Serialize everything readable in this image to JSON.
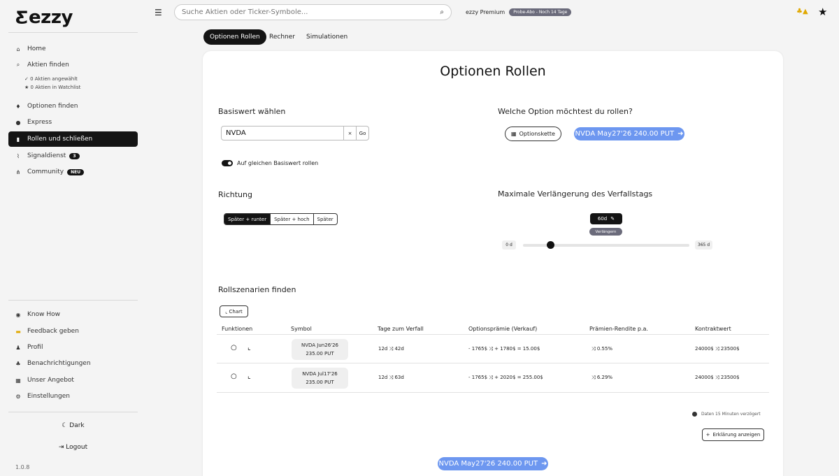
{
  "logo": {
    "text": "ezzy",
    "mark": "Ƹ"
  },
  "sidebar": {
    "items": [
      {
        "icon": "⌂",
        "label": "Home"
      },
      {
        "icon": "⌕",
        "label": "Aktien finden"
      },
      {
        "icon": "♦",
        "label": "Optionen finden"
      },
      {
        "icon": "●",
        "label": "Express"
      },
      {
        "icon": "▮",
        "label": "Rollen und schließen"
      },
      {
        "icon": "⌇",
        "label": "Signaldienst",
        "badge": "3"
      },
      {
        "icon": "⋔",
        "label": "Community",
        "badge": "NEU"
      }
    ],
    "subs": [
      {
        "icon": "✓",
        "label": "0 Aktien angewählt"
      },
      {
        "icon": "★",
        "label": "0 Aktien in Watchlist"
      }
    ],
    "bottom": [
      {
        "icon": "◉",
        "label": "Know How"
      },
      {
        "icon": "▬",
        "label": "Feedback geben"
      },
      {
        "icon": "♟",
        "label": "Profil"
      },
      {
        "icon": "♣",
        "label": "Benachrichtigungen"
      },
      {
        "icon": "▦",
        "label": "Unser Angebot"
      },
      {
        "icon": "⚙",
        "label": "Einstellungen"
      }
    ],
    "dark": "Dark",
    "logout": "Logout",
    "version": "1.0.8"
  },
  "topbar": {
    "search_placeholder": "Suche Aktien oder Ticker-Symbole...",
    "premium": "ezzy Premium",
    "trial": "Probe-Abo - Noch 14 Tage"
  },
  "tabs": [
    "Optionen Rollen",
    "Rechner",
    "Simulationen"
  ],
  "main": {
    "title": "Optionen Rollen",
    "basis_title": "Basiswert wählen",
    "ticker_value": "NVDA",
    "clear": "×",
    "go": "Go",
    "toggle_label": "Auf gleichen Basiswert rollen",
    "option_title": "Welche Option möchtest du rollen?",
    "chain_btn": "Optionskette",
    "selected_option": "NVDA May27'26 240.00 PUT",
    "direction_title": "Richtung",
    "directions": [
      "Später + runter",
      "Später + hoch",
      "Später"
    ],
    "max_ext_title": "Maximale Verlängerung des Verfallstags",
    "ext_value": "60d",
    "ext_btn": "Verlängern",
    "range_min": "0 d",
    "range_max": "365 d",
    "ext_fraction": 0.1644,
    "scen_title": "Rollszenarien finden",
    "chart_btn": "Chart",
    "delay_note": "Daten 15 Minuten verzögert",
    "explain_btn": "Erklärung anzeigen"
  },
  "table": {
    "headers": [
      "Funktionen",
      "Symbol",
      "Tage zum Verfall",
      "Optionsprämie (Verkauf)",
      "Prämien-Rendite p.a.",
      "Kontraktwert"
    ],
    "rows": [
      {
        "sym1": "NVDA Jun26'26",
        "sym2": "235.00 PUT",
        "days_a": "12d",
        "days_b": "42d",
        "prem_a": "- 1765$",
        "prem_b": "+ 1780$ = 15.00$",
        "yield": "0.55%",
        "cv_a": "24000$",
        "cv_b": "23500$"
      },
      {
        "sym1": "NVDA Jul17'26",
        "sym2": "235.00 PUT",
        "days_a": "12d",
        "days_b": "63d",
        "prem_a": "- 1765$",
        "prem_b": "+ 2020$ = 255.00$",
        "yield": "6.29%",
        "cv_a": "24000$",
        "cv_b": "23500$"
      }
    ]
  },
  "colors": {
    "accent": "#6d97f0",
    "dark": "#141414",
    "warn": "#e0a800"
  }
}
